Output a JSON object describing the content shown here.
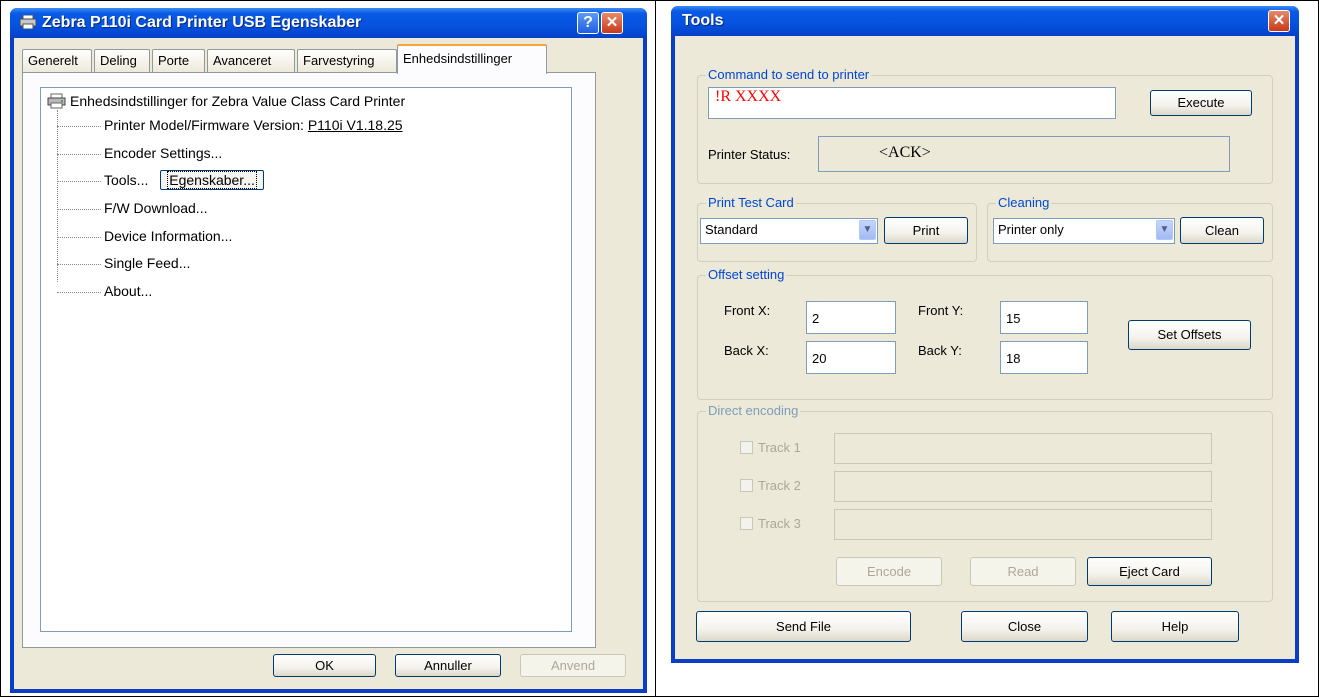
{
  "props": {
    "title": "Zebra P110i Card Printer USB Egenskaber",
    "tabs": [
      "Generelt",
      "Deling",
      "Porte",
      "Avanceret",
      "Farvestyring",
      "Enhedsindstillinger"
    ],
    "tree": {
      "root": "Enhedsindstillinger for Zebra Value Class Card Printer",
      "model_label": "Printer Model/Firmware Version:",
      "model_value": "P110i V1.18.25",
      "encoder": "Encoder Settings...",
      "tools": "Tools...",
      "tools_button": "Egenskaber...",
      "fw": "F/W Download...",
      "device_info": "Device Information...",
      "single_feed": "Single Feed...",
      "about": "About..."
    },
    "buttons": {
      "ok": "OK",
      "cancel": "Annuller",
      "apply": "Anvend"
    }
  },
  "tools": {
    "title": "Tools",
    "command": {
      "group_label": "Command to send to printer",
      "value": "!R XXXX",
      "execute": "Execute",
      "status_label": "Printer Status:",
      "status_value": "<ACK>",
      "accent": "#ff0000"
    },
    "test_card": {
      "group_label": "Print Test Card",
      "selected": "Standard",
      "print": "Print"
    },
    "cleaning": {
      "group_label": "Cleaning",
      "selected": "Printer only",
      "clean": "Clean"
    },
    "offset": {
      "group_label": "Offset setting",
      "front_x_label": "Front X:",
      "front_x": "2",
      "front_y_label": "Front Y:",
      "front_y": "15",
      "back_x_label": "Back X:",
      "back_x": "20",
      "back_y_label": "Back Y:",
      "back_y": "18",
      "set": "Set Offsets"
    },
    "encoding": {
      "group_label": "Direct encoding",
      "track1": "Track 1",
      "track2": "Track 2",
      "track3": "Track 3",
      "encode": "Encode",
      "read": "Read",
      "eject": "Eject Card"
    },
    "buttons": {
      "send_file": "Send File",
      "close": "Close",
      "help": "Help"
    }
  }
}
